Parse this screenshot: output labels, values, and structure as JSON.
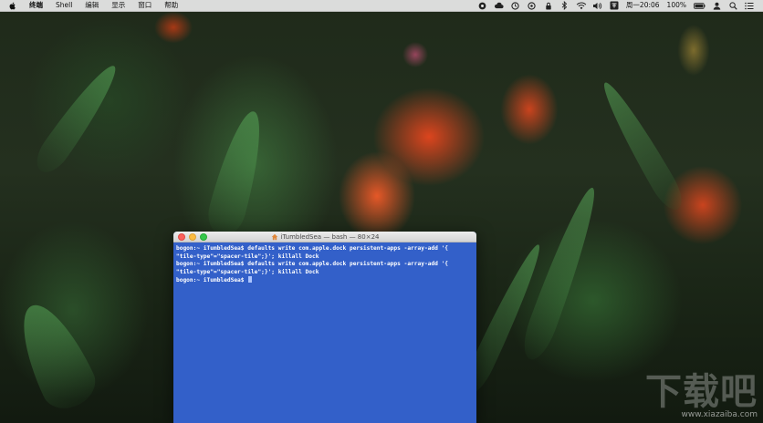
{
  "menubar": {
    "app_name": "终端",
    "items": [
      "Shell",
      "编辑",
      "显示",
      "窗口",
      "帮助"
    ],
    "status": {
      "battery": "100%",
      "clock": "周一20:06",
      "icons": [
        "record-icon",
        "cloud-icon",
        "time-machine-icon",
        "lock-icon",
        "bluetooth-icon",
        "wifi-icon",
        "volume-icon",
        "input-method-icon",
        "user-icon",
        "spotlight-icon",
        "notification-center-icon"
      ]
    }
  },
  "terminal": {
    "title": "iTumbledSea — bash — 80×24",
    "lines": [
      "bogon:~ iTumbledSea$ defaults write com.apple.dock persistent-apps -array-add '{",
      "\"tile-type\"=\"spacer-tile\";}'; killall Dock",
      "bogon:~ iTumbledSea$ defaults write com.apple.dock persistent-apps -array-add '{",
      "\"tile-type\"=\"spacer-tile\";}'; killall Dock",
      "bogon:~ iTumbledSea$ "
    ],
    "colors": {
      "background": "#3360c9",
      "text": "#ffffff"
    }
  },
  "watermark": {
    "logo": "下载吧",
    "url": "www.xiazaiba.com"
  }
}
